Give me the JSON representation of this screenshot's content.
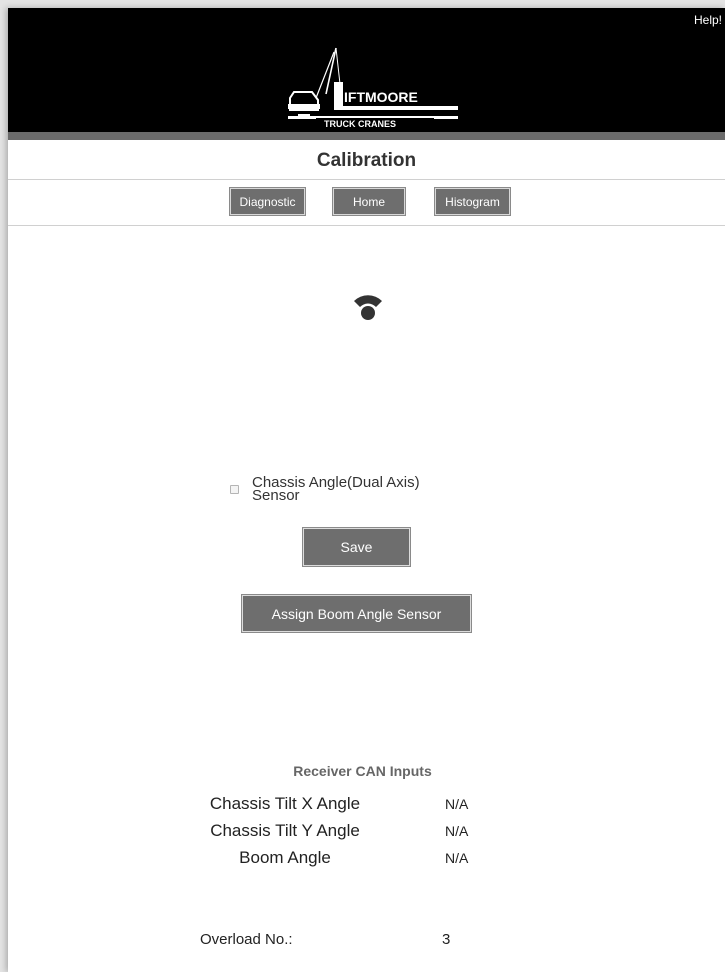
{
  "header": {
    "help_label": "Help!",
    "logo_top_text": "IFTMOORE",
    "logo_bottom_text": "TRUCK CRANES"
  },
  "page": {
    "title": "Calibration"
  },
  "nav": {
    "items": [
      {
        "label": "Diagnostic"
      },
      {
        "label": "Home"
      },
      {
        "label": "Histogram"
      }
    ]
  },
  "icons": {
    "connection": "wifi-signal-icon"
  },
  "sensor_option": {
    "label": "Chassis Angle(Dual Axis) Sensor",
    "checked": false
  },
  "actions": {
    "save_label": "Save",
    "assign_label": "Assign Boom Angle Sensor"
  },
  "can_inputs": {
    "title": "Receiver CAN Inputs",
    "rows": [
      {
        "label": "Chassis Tilt X Angle",
        "value": "N/A"
      },
      {
        "label": "Chassis Tilt Y Angle",
        "value": "N/A"
      },
      {
        "label": "Boom Angle",
        "value": "N/A"
      }
    ]
  },
  "overload": {
    "label": "Overload No.:",
    "value": "3"
  },
  "colors": {
    "header_bg": "#000000",
    "button_bg": "#6e6e6e",
    "button_text": "#ffffff"
  }
}
